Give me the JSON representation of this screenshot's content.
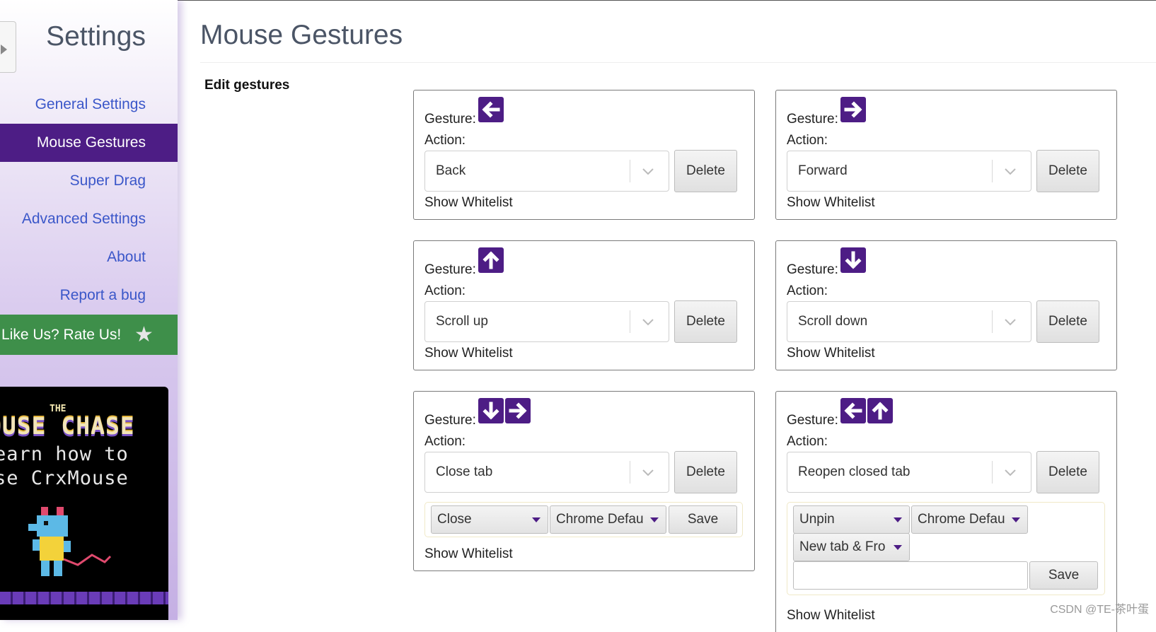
{
  "sidebar": {
    "title": "Settings",
    "nav": [
      {
        "label": "General Settings"
      },
      {
        "label": "Mouse Gestures"
      },
      {
        "label": "Super Drag"
      },
      {
        "label": "Advanced Settings"
      },
      {
        "label": "About"
      },
      {
        "label": "Report a bug"
      }
    ],
    "active_index": 1,
    "rate": {
      "label": "Like Us? Rate Us!",
      "icon": "star-icon"
    },
    "promo": {
      "small": "THE",
      "title": "OUSE CHASE",
      "line1": "earn how to",
      "line2": "se CrxMouse"
    }
  },
  "main": {
    "title": "Mouse Gestures",
    "section": "Edit gestures",
    "gesture_label": "Gesture:",
    "action_label": "Action:",
    "delete_label": "Delete",
    "whitelist_label": "Show Whitelist",
    "save_label": "Save",
    "gestures": [
      {
        "arrows": [
          "left"
        ],
        "action": "Back"
      },
      {
        "arrows": [
          "right"
        ],
        "action": "Forward"
      },
      {
        "arrows": [
          "up"
        ],
        "action": "Scroll up"
      },
      {
        "arrows": [
          "down"
        ],
        "action": "Scroll down"
      },
      {
        "arrows": [
          "down",
          "right"
        ],
        "action": "Close tab",
        "options": {
          "mode": "Close",
          "target": "Chrome Defau"
        }
      },
      {
        "arrows": [
          "left",
          "up"
        ],
        "action": "Reopen closed tab",
        "options": {
          "mode": "Unpin",
          "target": "Chrome Defau",
          "position": "New tab & Fro",
          "text_value": ""
        }
      }
    ]
  },
  "colors": {
    "accent": "#4d1d85",
    "link": "#3b57c9",
    "rate_bg": "#3e8f4a"
  },
  "watermark": "CSDN @TE-茶叶蛋"
}
